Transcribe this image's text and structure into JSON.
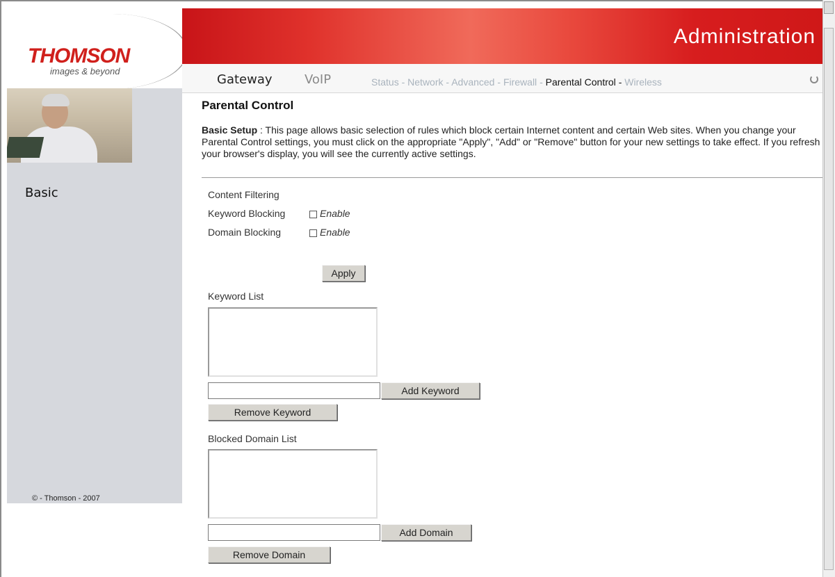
{
  "header": {
    "logo": "THOMSON",
    "tagline": "images & beyond",
    "title": "Administration"
  },
  "nav": {
    "main": [
      "Gateway",
      "VoIP"
    ],
    "sub": [
      {
        "label": "Status",
        "active": false
      },
      {
        "label": "Network",
        "active": false
      },
      {
        "label": "Advanced",
        "active": false
      },
      {
        "label": "Firewall",
        "active": false
      },
      {
        "label": "Parental Control",
        "active": true
      },
      {
        "label": "Wireless",
        "active": false
      }
    ],
    "separator": "-"
  },
  "sidebar": {
    "items": [
      {
        "label": "Basic"
      }
    ],
    "copyright": "© - Thomson - 2007"
  },
  "page": {
    "title": "Parental Control",
    "intro_bold": "Basic Setup",
    "intro_text": " :  This page allows basic selection of rules which block certain Internet content and certain Web sites. When you change your Parental Control settings, you must click on the appropriate \"Apply\", \"Add\" or \"Remove\" button for your new settings to take effect. If you refresh your browser's display, you will see the currently active settings."
  },
  "filtering": {
    "heading": "Content Filtering",
    "keyword_blocking": {
      "label": "Keyword Blocking",
      "checkbox_label": "Enable",
      "checked": false
    },
    "domain_blocking": {
      "label": "Domain Blocking",
      "checkbox_label": "Enable",
      "checked": false
    },
    "apply_label": "Apply"
  },
  "keyword_list": {
    "label": "Keyword List",
    "items": [],
    "input_value": "",
    "add_label": "Add Keyword",
    "remove_label": "Remove Keyword"
  },
  "domain_list": {
    "label": "Blocked Domain List",
    "items": [],
    "input_value": "",
    "add_label": "Add Domain",
    "remove_label": "Remove Domain"
  },
  "colors": {
    "brand_red": "#d0201c",
    "banner_red": "#e0322c",
    "sidebar_gray": "#d6d8dd",
    "inactive_link": "#a9b3bd"
  }
}
